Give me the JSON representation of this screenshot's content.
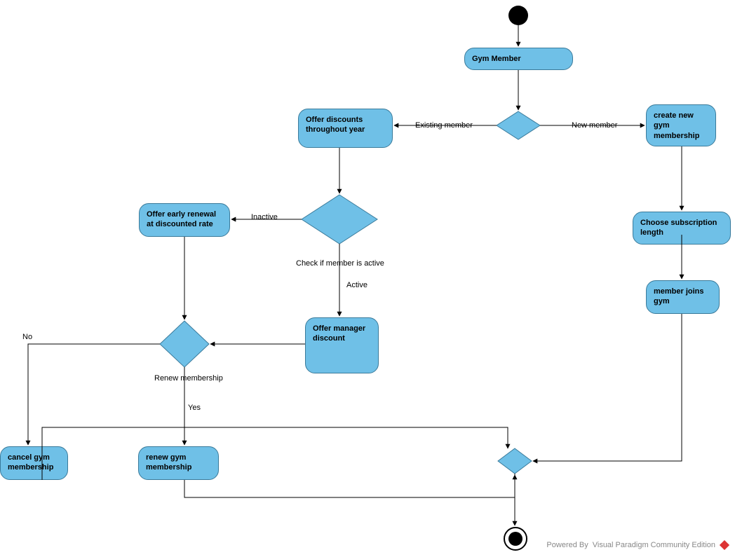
{
  "nodes": {
    "gymMember": "Gym Member",
    "offerDiscountsYear": "Offer discounts throughout year",
    "createMembership": "create new gym membership",
    "earlyRenewal": "Offer early renewal at discounted rate",
    "chooseSubscription": "Choose subscription length",
    "managerDiscount": "Offer manager discount",
    "memberJoins": "member joins gym",
    "cancelMembership": "cancel gym membership",
    "renewMembership": "renew gym membership"
  },
  "edgeLabels": {
    "existingMember": "Existing member",
    "newMember": "New member",
    "inactive": "Inactive",
    "active": "Active",
    "checkActive": "Check if member is active",
    "renewDecision": "Renew membership",
    "no": "No",
    "yes": "Yes"
  },
  "watermark": {
    "prefix": "Powered By",
    "product": "Visual Paradigm Community Edition"
  },
  "chart_data": {
    "type": "diagram",
    "diagram_type": "UML Activity Diagram",
    "nodes": [
      {
        "id": "start",
        "type": "initial"
      },
      {
        "id": "gymMember",
        "type": "activity",
        "label": "Gym Member"
      },
      {
        "id": "d1",
        "type": "decision"
      },
      {
        "id": "offerDiscountsYear",
        "type": "activity",
        "label": "Offer discounts throughout year"
      },
      {
        "id": "createMembership",
        "type": "activity",
        "label": "create new gym membership"
      },
      {
        "id": "d2",
        "type": "decision",
        "label": "Check if member is active"
      },
      {
        "id": "earlyRenewal",
        "type": "activity",
        "label": "Offer early renewal at discounted rate"
      },
      {
        "id": "chooseSubscription",
        "type": "activity",
        "label": "Choose subscription length"
      },
      {
        "id": "managerDiscount",
        "type": "activity",
        "label": "Offer manager discount"
      },
      {
        "id": "memberJoins",
        "type": "activity",
        "label": "member joins gym"
      },
      {
        "id": "d3",
        "type": "decision",
        "label": "Renew membership"
      },
      {
        "id": "cancelMembership",
        "type": "activity",
        "label": "cancel gym membership"
      },
      {
        "id": "renewMembership",
        "type": "activity",
        "label": "renew gym membership"
      },
      {
        "id": "merge",
        "type": "merge"
      },
      {
        "id": "end",
        "type": "final"
      }
    ],
    "edges": [
      {
        "from": "start",
        "to": "gymMember"
      },
      {
        "from": "gymMember",
        "to": "d1"
      },
      {
        "from": "d1",
        "to": "offerDiscountsYear",
        "label": "Existing member"
      },
      {
        "from": "d1",
        "to": "createMembership",
        "label": "New member"
      },
      {
        "from": "offerDiscountsYear",
        "to": "d2"
      },
      {
        "from": "d2",
        "to": "earlyRenewal",
        "label": "Inactive"
      },
      {
        "from": "d2",
        "to": "managerDiscount",
        "label": "Active"
      },
      {
        "from": "createMembership",
        "to": "chooseSubscription"
      },
      {
        "from": "chooseSubscription",
        "to": "memberJoins"
      },
      {
        "from": "earlyRenewal",
        "to": "d3"
      },
      {
        "from": "managerDiscount",
        "to": "d3"
      },
      {
        "from": "d3",
        "to": "cancelMembership",
        "label": "No"
      },
      {
        "from": "d3",
        "to": "renewMembership",
        "label": "Yes"
      },
      {
        "from": "memberJoins",
        "to": "merge"
      },
      {
        "from": "cancelMembership",
        "to": "merge"
      },
      {
        "from": "renewMembership",
        "to": "merge"
      },
      {
        "from": "merge",
        "to": "end"
      }
    ]
  }
}
